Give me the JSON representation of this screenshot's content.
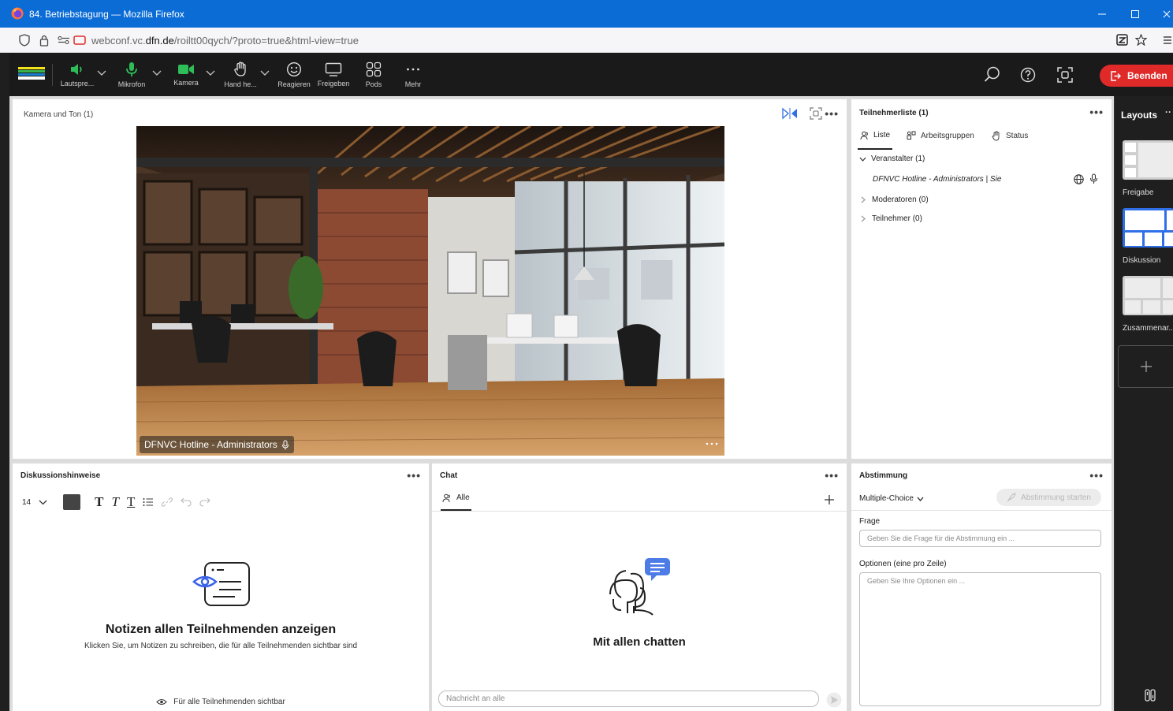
{
  "browser": {
    "window_title": "84. Betriebstagung — Mozilla Firefox",
    "url_prefix": "webconf.vc.",
    "url_domain": "dfn.de",
    "url_path": "/roiltt00qych/?proto=true&html-view=true"
  },
  "toolbar": {
    "speaker": "Lautspre...",
    "mic": "Mikrofon",
    "camera": "Kamera",
    "hand": "Hand he...",
    "react": "Reagieren",
    "share": "Freigeben",
    "pods": "Pods",
    "more": "Mehr",
    "end": "Beenden"
  },
  "video_pod": {
    "title": "Kamera und Ton (1)",
    "name_tag": "DFNVC Hotline - Administrators",
    "menu": "•••"
  },
  "attendees": {
    "title": "Teilnehmerliste (1)",
    "tabs": [
      "Liste",
      "Arbeitsgruppen",
      "Status"
    ],
    "groups": {
      "hosts": "Veranstalter (1)",
      "host_entry": "DFNVC Hotline - Administrators | Sie",
      "presenters": "Moderatoren (0)",
      "participants": "Teilnehmer (0)"
    }
  },
  "notes": {
    "title": "Diskussionshinweise",
    "font_size": "14",
    "heading": "Notizen allen Teilnehmenden anzeigen",
    "subtext": "Klicken Sie, um Notizen zu schreiben, die für alle Teilnehmenden sichtbar sind",
    "visibility": "Für alle Teilnehmenden sichtbar"
  },
  "chat": {
    "title": "Chat",
    "tab": "Alle",
    "heading": "Mit allen chatten",
    "placeholder": "Nachricht an alle"
  },
  "poll": {
    "title": "Abstimmung",
    "type": "Multiple-Choice",
    "start": "Abstimmung starten",
    "question_label": "Frage",
    "question_placeholder": "Geben Sie die Frage für die Abstimmung ein ...",
    "options_label": "Optionen (eine pro Zeile)",
    "options_placeholder": "Geben Sie Ihre Optionen ein ..."
  },
  "layouts": {
    "title": "Layouts",
    "items": [
      "Freigabe",
      "Diskussion",
      "Zusammenar..."
    ]
  },
  "colors": {
    "firefox_blue": "#0b6cd6",
    "end_red": "#e02a2a",
    "mic_green": "#2ebd59",
    "layout_selected": "#2f6fe8"
  }
}
